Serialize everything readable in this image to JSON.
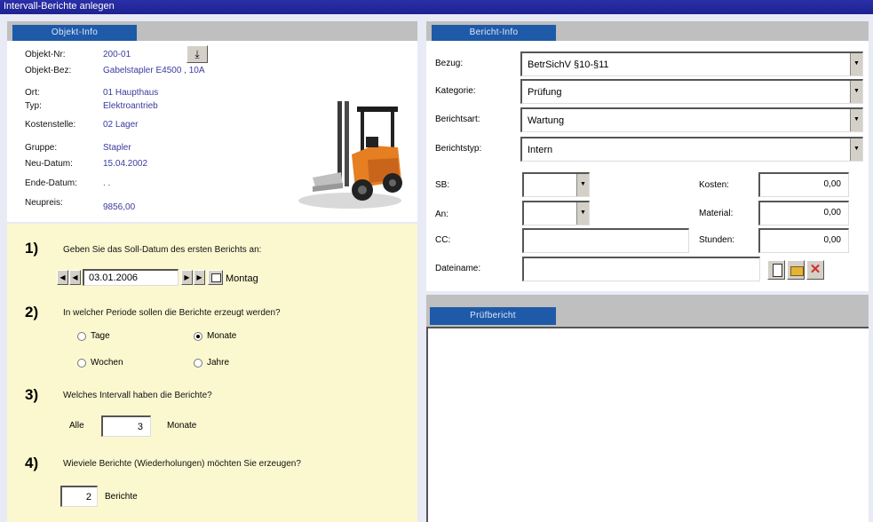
{
  "window": {
    "title": "Intervall-Berichte anlegen"
  },
  "objekt": {
    "tab": "Objekt-Info",
    "fields": [
      {
        "label": "Objekt-Nr:",
        "value": "200-01"
      },
      {
        "label": "Objekt-Bez:",
        "value": "Gabelstapler E4500 , 10A"
      },
      {
        "label": "Ort:",
        "value": "01 Haupthaus"
      },
      {
        "label": "Typ:",
        "value": "Elektroantrieb"
      },
      {
        "label": "Kostenstelle:",
        "value": "02 Lager"
      },
      {
        "label": "Gruppe:",
        "value": "Stapler"
      },
      {
        "label": "Neu-Datum:",
        "value": "15.04.2002"
      },
      {
        "label": "Ende-Datum:",
        "value": ". ."
      },
      {
        "label": "Neupreis:",
        "value": "9856,00"
      }
    ]
  },
  "wizard": {
    "step1": {
      "num": "1)",
      "question": "Geben Sie das Soll-Datum des ersten Berichts an:",
      "date": "03.01.2006",
      "weekday": "Montag"
    },
    "step2": {
      "num": "2)",
      "question": "In welcher Periode sollen die Berichte erzeugt werden?",
      "options": {
        "tage": "Tage",
        "monate": "Monate",
        "wochen": "Wochen",
        "jahre": "Jahre"
      },
      "selected": "Monate"
    },
    "step3": {
      "num": "3)",
      "question": "Welches Intervall haben die Berichte?",
      "prefix": "Alle",
      "value": "3",
      "suffix": "Monate"
    },
    "step4": {
      "num": "4)",
      "question": "Wieviele Berichte (Wiederholungen) möchten Sie erzeugen?",
      "value": "2",
      "suffix": "Berichte"
    }
  },
  "bericht": {
    "tab": "Bericht-Info",
    "bezug": {
      "label": "Bezug:",
      "value": "BetrSichV §10-§11"
    },
    "kategorie": {
      "label": "Kategorie:",
      "value": "Prüfung"
    },
    "berichtsart": {
      "label": "Berichtsart:",
      "value": "Wartung"
    },
    "berichtstyp": {
      "label": "Berichtstyp:",
      "value": "Intern"
    },
    "sb_label": "SB:",
    "an_label": "An:",
    "cc_label": "CC:",
    "dateiname_label": "Dateiname:",
    "kosten": {
      "label": "Kosten:",
      "value": "0,00"
    },
    "material": {
      "label": "Material:",
      "value": "0,00"
    },
    "stunden": {
      "label": "Stunden:",
      "value": "0,00"
    }
  },
  "pruefbericht": {
    "tab": "Prüfbericht"
  },
  "colors": {
    "title": "#1d2390",
    "tab": "#1e5aa8",
    "wizard_bg": "#fbf8cf",
    "close_red": "#d2302a"
  },
  "icons": {
    "down_arrow": "▼",
    "first": "◀",
    "prev": "◀",
    "next": "▶",
    "last": "▶"
  }
}
